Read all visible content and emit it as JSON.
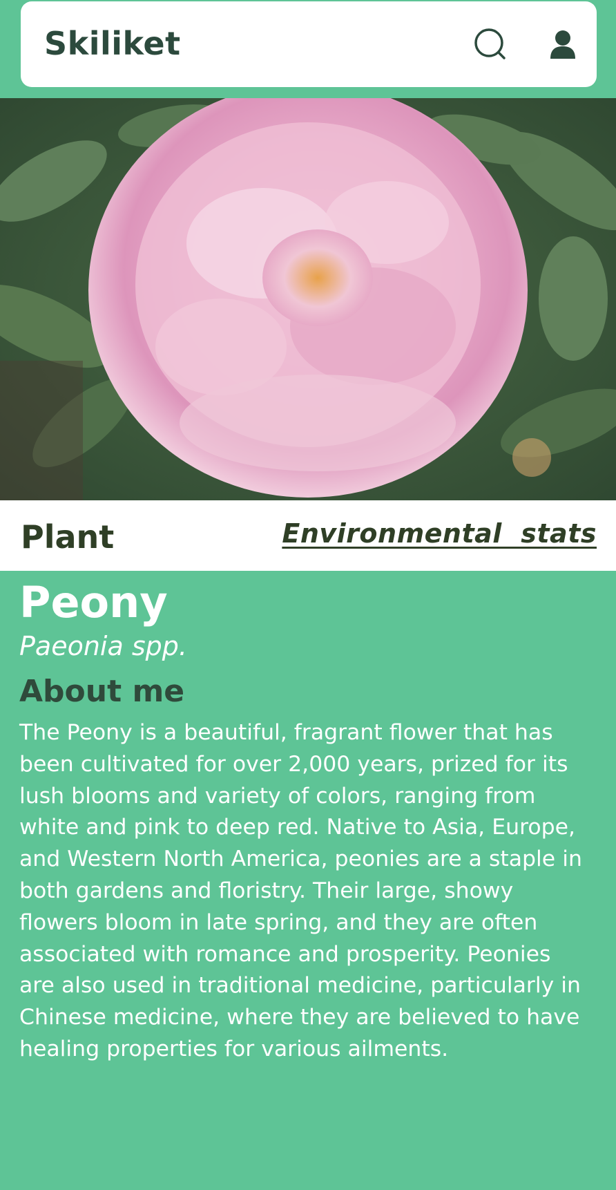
{
  "header": {
    "app_name": "Skiliket",
    "search_icon": "search-icon",
    "user_icon": "user-icon"
  },
  "hero": {
    "image_description": "pink-peony-photo"
  },
  "tabs": {
    "plant_label": "Plant",
    "environmental_label": "Environmental  stats"
  },
  "plant": {
    "common_name": "Peony",
    "scientific_name": "Paeonia spp.",
    "about_heading": "About me",
    "about_text": "The Peony is a beautiful, fragrant flower that has been cultivated for over 2,000 years, prized for its lush blooms and variety of colors, ranging from white and pink to deep red. Native to Asia, Europe, and Western North America, peonies are a staple in both gardens and floristry. Their large, showy flowers bloom in late spring, and they are often associated with romance and prosperity. Peonies are also used in traditional medicine, particularly in Chinese medicine, where they are believed to have healing properties for various ailments."
  },
  "colors": {
    "page_background": "#5ec496",
    "header_background": "#ffffff",
    "title_color": "#2c4a3d",
    "tab_text": "#2f3f26",
    "body_text": "#ffffff"
  }
}
